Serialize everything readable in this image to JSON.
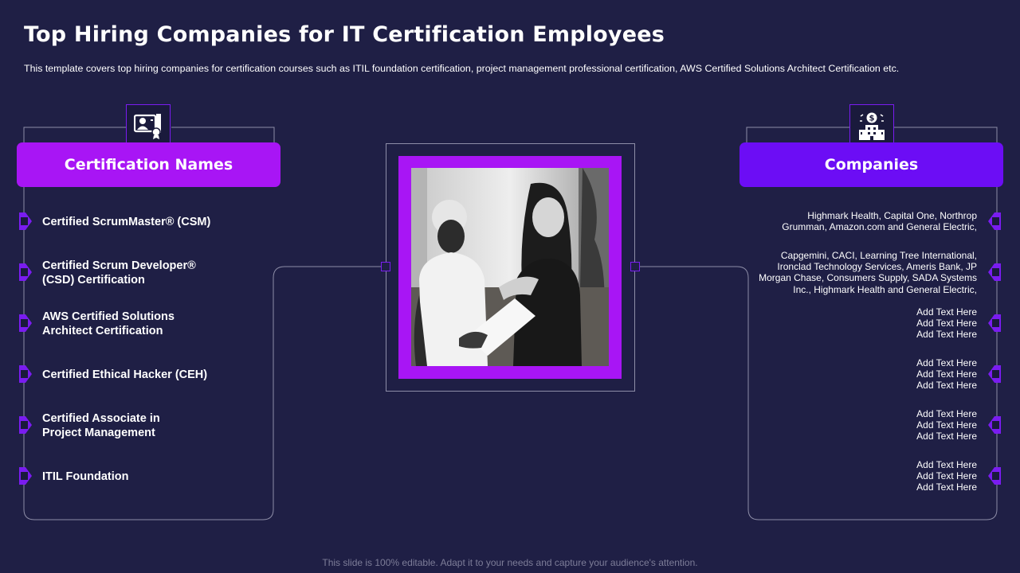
{
  "slide": {
    "title": "Top Hiring Companies for IT Certification Employees",
    "subtitle": "This template covers top hiring companies for certification courses such as ITIL foundation certification, project management professional  certification, AWS Certified Solutions Architect Certification etc.",
    "footer": "This slide is 100% editable. Adapt it to your needs and capture your audience's attention."
  },
  "left_panel": {
    "header": "Certification  Names",
    "icon": "certificate-icon",
    "items": [
      "Certified ScrumMaster® (CSM)",
      "Certified Scrum Developer® (CSD) Certification",
      "AWS Certified Solutions Architect Certification",
      "Certified Ethical Hacker (CEH)",
      "Certified Associate in Project Management",
      "ITIL Foundation"
    ]
  },
  "right_panel": {
    "header": "Companies",
    "icon": "bank-building-icon",
    "items": [
      "Highmark Health, Capital One, Northrop Grumman, Amazon.com and General Electric,",
      "Capgemini, CACI, Learning Tree International, Ironclad Technology Services, Ameris Bank, JP Morgan Chase, Consumers Supply, SADA Systems Inc., Highmark Health and General Electric,",
      "Add Text Here Add Text Here Add Text Here",
      "Add Text Here Add Text Here Add Text Here",
      "Add Text Here Add Text Here Add Text Here",
      "Add Text Here Add Text Here Add Text Here"
    ]
  },
  "photo": {
    "icon": "two-women-photo"
  },
  "colors": {
    "background": "#1f1f45",
    "magenta": "#a815f5",
    "violet": "#6c0df5",
    "bullet": "#7a1cf0",
    "outline": "#8e8ea8"
  }
}
